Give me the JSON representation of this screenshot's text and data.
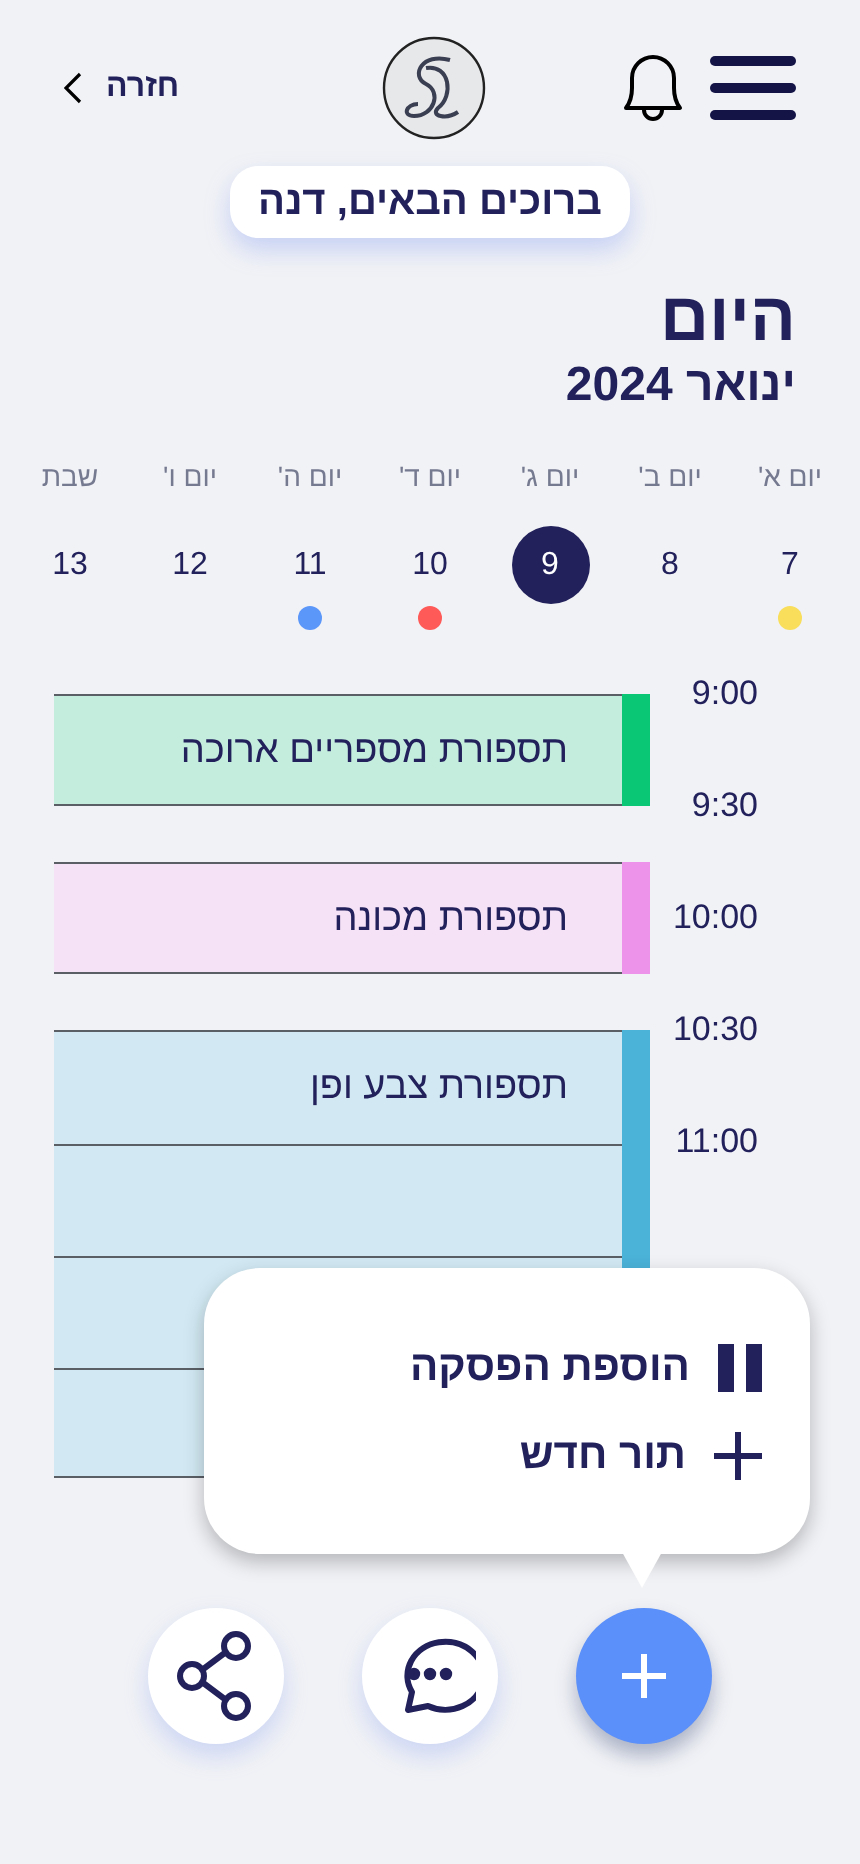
{
  "header": {
    "back_label": "חזרה",
    "greeting": "ברוכים הבאים, דנה"
  },
  "title": "היום",
  "month": "ינואר 2024",
  "days": [
    {
      "name": "יום א'",
      "number": "7",
      "selected": false,
      "color": "#f8de5a"
    },
    {
      "name": "יום ב'",
      "number": "8",
      "selected": false
    },
    {
      "name": "יום ג'",
      "number": "9",
      "selected": true
    },
    {
      "name": "יום ד'",
      "number": "10",
      "selected": false,
      "color": "#fe5a57"
    },
    {
      "name": "יום ה'",
      "number": "11",
      "selected": false,
      "color": "#5b96f9"
    },
    {
      "name": "יום ו'",
      "number": "12",
      "selected": false
    },
    {
      "name": "שבת",
      "number": "13",
      "selected": false
    }
  ],
  "times": [
    "9:00",
    "9:30",
    "10:00",
    "10:30",
    "11:00"
  ],
  "events": [
    {
      "title": "תספורת מספריים ארוכה",
      "color": "#0ac775"
    },
    {
      "title": "תספורת מכונה",
      "color": "#ee93ea"
    },
    {
      "title": "תספורת צבע ופן",
      "color": "#4bb2d8"
    }
  ],
  "menu": [
    {
      "label": "הוספת הפסקה",
      "kind": "pause"
    },
    {
      "label": "תור חדש",
      "kind": "plus"
    }
  ],
  "actions": [
    {
      "kind": "share"
    },
    {
      "kind": "chat"
    },
    {
      "kind": "add"
    }
  ]
}
